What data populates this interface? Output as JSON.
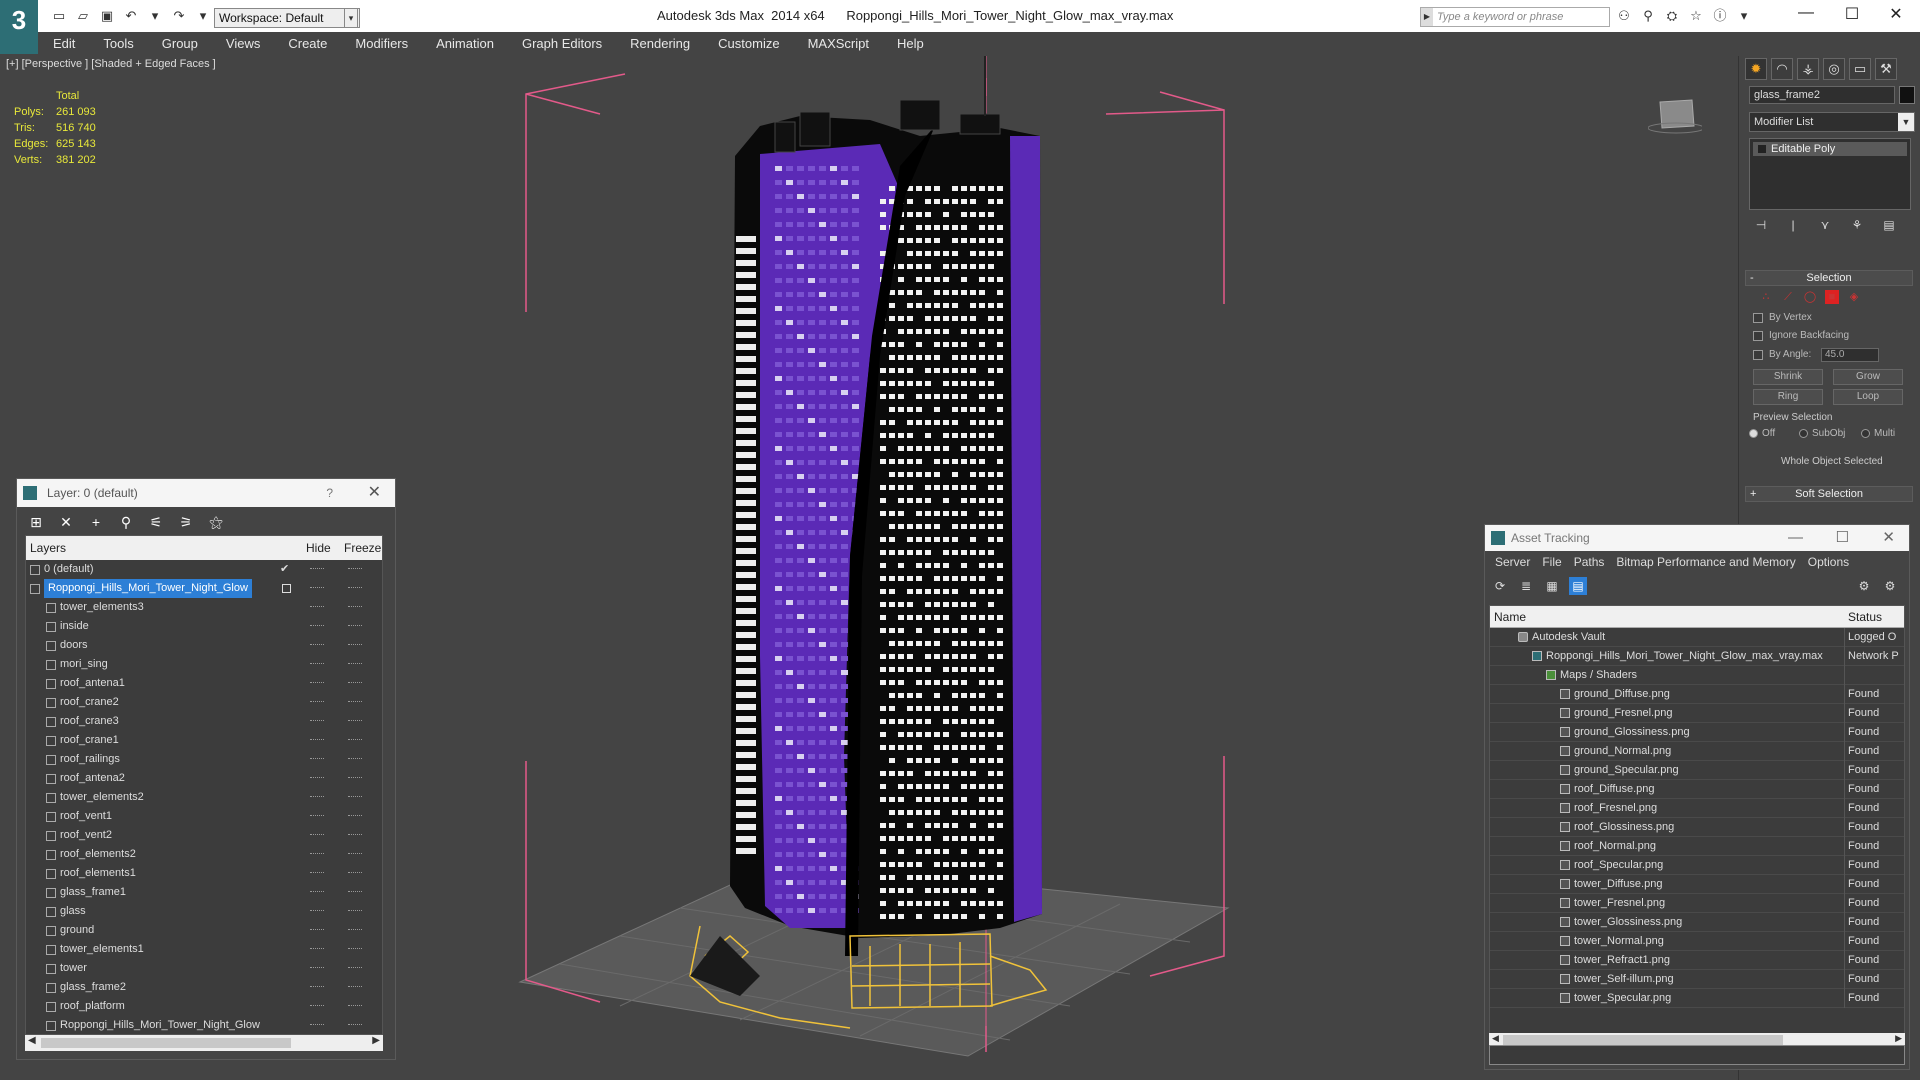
{
  "titlebar": {
    "workspace": "Workspace: Default",
    "title": "Autodesk 3ds Max  2014 x64      Roppongi_Hills_Mori_Tower_Night_Glow_max_vray.max",
    "search_placeholder": "Type a keyword or phrase"
  },
  "menu": [
    "Edit",
    "Tools",
    "Group",
    "Views",
    "Create",
    "Modifiers",
    "Animation",
    "Graph Editors",
    "Rendering",
    "Customize",
    "MAXScript",
    "Help"
  ],
  "viewport": {
    "label": "[+] [Perspective ] [Shaded + Edged Faces ]",
    "stats": {
      "header": "Total",
      "rows": [
        {
          "k": "Polys:",
          "v": "261 093"
        },
        {
          "k": "Tris:",
          "v": "516 740"
        },
        {
          "k": "Edges:",
          "v": "625 143"
        },
        {
          "k": "Verts:",
          "v": "381 202"
        }
      ]
    }
  },
  "layers": {
    "title": "Layer: 0 (default)",
    "help": "?",
    "col_layers": "Layers",
    "col_hide": "Hide",
    "col_freeze": "Freeze",
    "rows": [
      "0 (default)",
      "Roppongi_Hills_Mori_Tower_Night_Glow",
      "tower_elements3",
      "inside",
      "doors",
      "mori_sing",
      "roof_antena1",
      "roof_crane2",
      "roof_crane3",
      "roof_crane1",
      "roof_railings",
      "roof_antena2",
      "tower_elements2",
      "roof_vent1",
      "roof_vent2",
      "roof_elements2",
      "roof_elements1",
      "glass_frame1",
      "glass",
      "ground",
      "tower_elements1",
      "tower",
      "glass_frame2",
      "roof_platform",
      "Roppongi_Hills_Mori_Tower_Night_Glow"
    ]
  },
  "cmdpanel": {
    "object_name": "glass_frame2",
    "modifier_list": "Modifier List",
    "stack_item": "Editable Poly",
    "selection_title": "Selection",
    "by_vertex": "By Vertex",
    "ignore_backfacing": "Ignore Backfacing",
    "by_angle": "By Angle:",
    "angle_value": "45.0",
    "shrink": "Shrink",
    "grow": "Grow",
    "ring": "Ring",
    "loop": "Loop",
    "preview_selection": "Preview Selection",
    "off": "Off",
    "subobj": "SubObj",
    "multi": "Multi",
    "whole_object": "Whole Object Selected",
    "soft_selection": "Soft Selection",
    "minus": "-",
    "plus": "+"
  },
  "asset": {
    "title": "Asset Tracking",
    "menu": [
      "Server",
      "File",
      "Paths",
      "Bitmap Performance and Memory",
      "Options"
    ],
    "col_name": "Name",
    "col_status": "Status",
    "rows": [
      {
        "name": "Autodesk Vault",
        "status": "Logged O",
        "indent": 1,
        "icon": "vault"
      },
      {
        "name": "Roppongi_Hills_Mori_Tower_Night_Glow_max_vray.max",
        "status": "Network P",
        "indent": 2,
        "icon": "max"
      },
      {
        "name": "Maps / Shaders",
        "status": "",
        "indent": 3,
        "icon": "folder"
      },
      {
        "name": "ground_Diffuse.png",
        "status": "Found",
        "indent": 4,
        "icon": "file"
      },
      {
        "name": "ground_Fresnel.png",
        "status": "Found",
        "indent": 4,
        "icon": "file"
      },
      {
        "name": "ground_Glossiness.png",
        "status": "Found",
        "indent": 4,
        "icon": "file"
      },
      {
        "name": "ground_Normal.png",
        "status": "Found",
        "indent": 4,
        "icon": "file"
      },
      {
        "name": "ground_Specular.png",
        "status": "Found",
        "indent": 4,
        "icon": "file"
      },
      {
        "name": "roof_Diffuse.png",
        "status": "Found",
        "indent": 4,
        "icon": "file"
      },
      {
        "name": "roof_Fresnel.png",
        "status": "Found",
        "indent": 4,
        "icon": "file"
      },
      {
        "name": "roof_Glossiness.png",
        "status": "Found",
        "indent": 4,
        "icon": "file"
      },
      {
        "name": "roof_Normal.png",
        "status": "Found",
        "indent": 4,
        "icon": "file"
      },
      {
        "name": "roof_Specular.png",
        "status": "Found",
        "indent": 4,
        "icon": "file"
      },
      {
        "name": "tower_Diffuse.png",
        "status": "Found",
        "indent": 4,
        "icon": "file"
      },
      {
        "name": "tower_Fresnel.png",
        "status": "Found",
        "indent": 4,
        "icon": "file"
      },
      {
        "name": "tower_Glossiness.png",
        "status": "Found",
        "indent": 4,
        "icon": "file"
      },
      {
        "name": "tower_Normal.png",
        "status": "Found",
        "indent": 4,
        "icon": "file"
      },
      {
        "name": "tower_Refract1.png",
        "status": "Found",
        "indent": 4,
        "icon": "file"
      },
      {
        "name": "tower_Self-illum.png",
        "status": "Found",
        "indent": 4,
        "icon": "file"
      },
      {
        "name": "tower_Specular.png",
        "status": "Found",
        "indent": 4,
        "icon": "file"
      }
    ]
  }
}
